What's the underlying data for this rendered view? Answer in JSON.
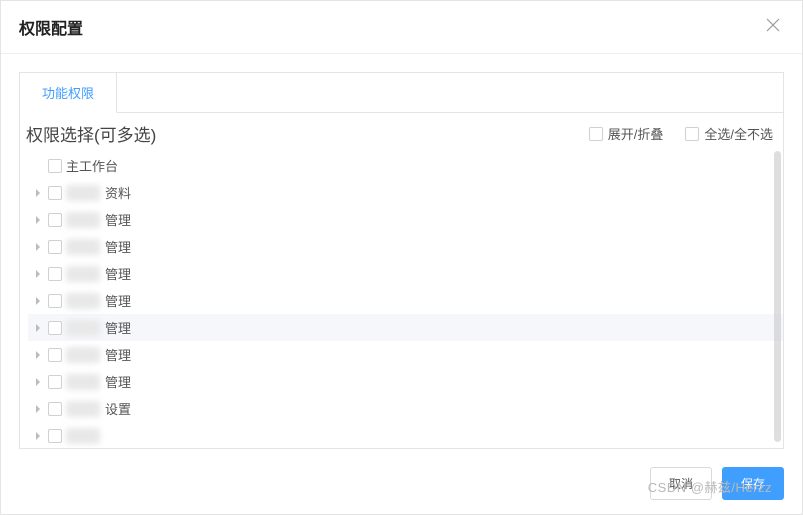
{
  "dialog": {
    "title": "权限配置"
  },
  "tabs": [
    {
      "label": "功能权限",
      "active": true
    }
  ],
  "tree": {
    "title": "权限选择(可多选)",
    "controls": {
      "expand_collapse": "展开/折叠",
      "select_all": "全选/全不选"
    },
    "items": [
      {
        "label_prefix": "",
        "label_suffix": "主工作台",
        "has_children": false,
        "blurred": false
      },
      {
        "label_prefix": "",
        "label_suffix": "资料",
        "has_children": true,
        "blurred": true
      },
      {
        "label_prefix": "",
        "label_suffix": "管理",
        "has_children": true,
        "blurred": true
      },
      {
        "label_prefix": "",
        "label_suffix": "管理",
        "has_children": true,
        "blurred": true
      },
      {
        "label_prefix": "",
        "label_suffix": "管理",
        "has_children": true,
        "blurred": true
      },
      {
        "label_prefix": "",
        "label_suffix": "管理",
        "has_children": true,
        "blurred": true
      },
      {
        "label_prefix": "",
        "label_suffix": "管理",
        "has_children": true,
        "blurred": true,
        "hover": true
      },
      {
        "label_prefix": "",
        "label_suffix": "管理",
        "has_children": true,
        "blurred": true
      },
      {
        "label_prefix": "",
        "label_suffix": "管理",
        "has_children": true,
        "blurred": true
      },
      {
        "label_prefix": "",
        "label_suffix": "设置",
        "has_children": true,
        "blurred": true
      },
      {
        "label_prefix": "",
        "label_suffix": "",
        "has_children": true,
        "blurred": true
      }
    ]
  },
  "footer": {
    "cancel": "取消",
    "save": "保存"
  },
  "watermark": "CSDN @赫兹/Herzz"
}
